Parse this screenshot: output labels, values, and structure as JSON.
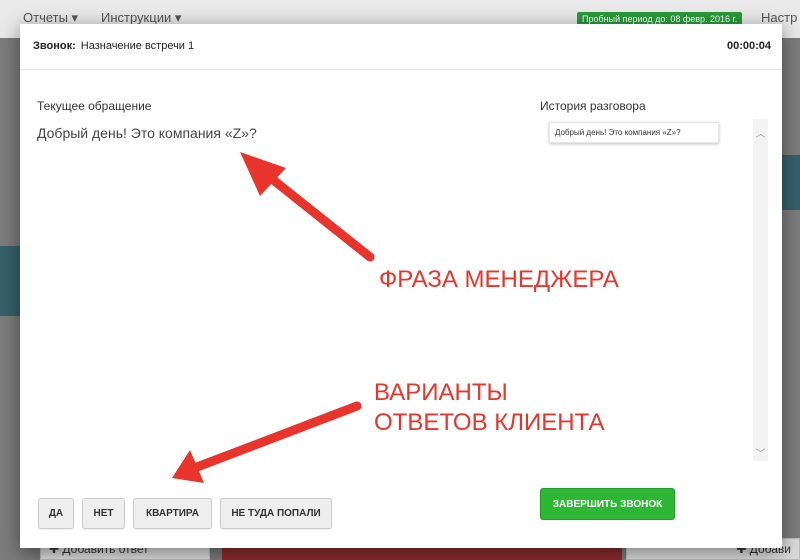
{
  "background": {
    "nav": {
      "reports": "Отчеты ▾",
      "instructions": "Инструкции ▾",
      "settings": "Настр"
    },
    "trial_badge": "Пробный период до: 08 февр. 2016 г.",
    "add_answer_left": "✚ Добавить ответ",
    "add_answer_right": "✚ Добави"
  },
  "modal": {
    "title_label": "Звонок:",
    "title_value": "Назначение встречи 1",
    "timer": "00:00:04",
    "current_label": "Текущее обращение",
    "current_phrase": "Добрый день! Это компания «Z»?",
    "history_label": "История разговора",
    "history_items": [
      "Добрый день! Это компания «Z»?"
    ],
    "answers": [
      "ДА",
      "НЕТ",
      "КВАРТИРА",
      "НЕ ТУДА ПОПАЛИ"
    ],
    "finish_label": "ЗАВЕРШИТЬ ЗВОНОК"
  },
  "annotations": {
    "manager_phrase": "ФРАЗА МЕНЕДЖЕРА",
    "client_answers_line1": "ВАРИАНТЫ",
    "client_answers_line2": "ОТВЕТОВ КЛИЕНТА"
  },
  "colors": {
    "finish_green": "#2db734",
    "annotation_red": "#e8342a",
    "trial_green": "#2a9a3a"
  }
}
